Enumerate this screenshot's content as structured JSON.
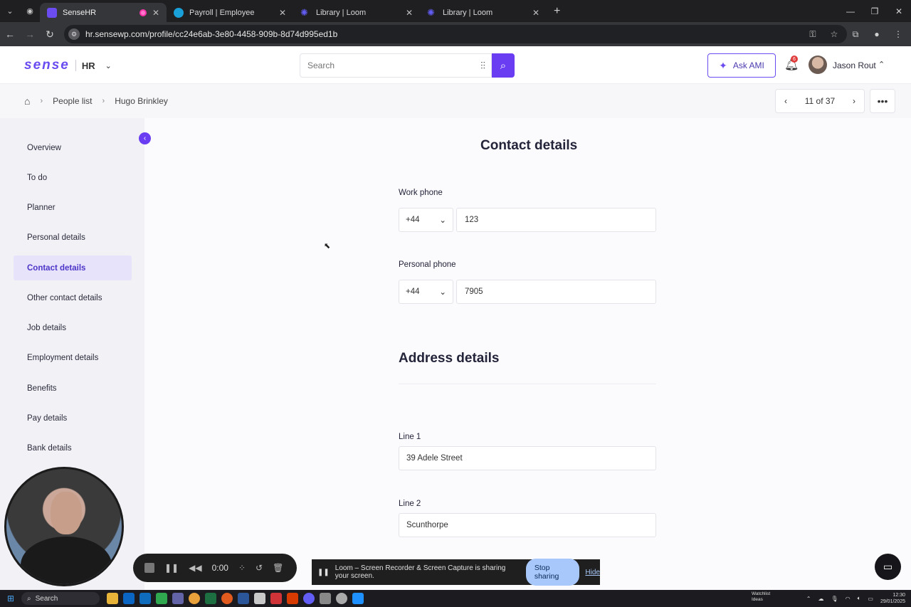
{
  "browser": {
    "tabs": [
      {
        "title": "SenseHR",
        "active": true,
        "color": "#6a4cf0"
      },
      {
        "title": "Payroll | Employee",
        "active": false,
        "color": "#1aa0d8"
      },
      {
        "title": "Library | Loom",
        "active": false,
        "color": "#625df5"
      },
      {
        "title": "Library | Loom",
        "active": false,
        "color": "#625df5"
      }
    ],
    "url": "hr.sensewp.com/profile/cc24e6ab-3e80-4458-909b-8d74d995ed1b"
  },
  "header": {
    "logo": "sense",
    "product": "HR",
    "search_placeholder": "Search",
    "ask_label": "Ask AMI",
    "notification_count": "6",
    "user_name": "Jason Rout"
  },
  "breadcrumb": {
    "items": [
      "People list",
      "Hugo Brinkley"
    ]
  },
  "pager": {
    "label": "11 of 37"
  },
  "sidebar": {
    "items": [
      {
        "label": "Overview"
      },
      {
        "label": "To do"
      },
      {
        "label": "Planner"
      },
      {
        "label": "Personal details"
      },
      {
        "label": "Contact details",
        "active": true
      },
      {
        "label": "Other contact details"
      },
      {
        "label": "Job details"
      },
      {
        "label": "Employment details"
      },
      {
        "label": "Benefits"
      },
      {
        "label": "Pay details"
      },
      {
        "label": "Bank details"
      }
    ]
  },
  "contact": {
    "title": "Contact details",
    "work_phone_label": "Work phone",
    "work_phone_code": "+44",
    "work_phone_value": "123",
    "personal_phone_label": "Personal phone",
    "personal_phone_code": "+44",
    "personal_phone_value": "7905"
  },
  "address": {
    "title": "Address details",
    "line1_label": "Line 1",
    "line1_value": "39 Adele Street",
    "line2_label": "Line 2",
    "line2_value": "Scunthorpe"
  },
  "loom": {
    "timer": "0:00",
    "share_message": "Loom – Screen Recorder & Screen Capture is sharing your screen.",
    "stop_label": "Stop sharing",
    "hide_label": "Hide"
  },
  "taskbar": {
    "search_label": "Search",
    "widget_title": "Watchlist",
    "widget_sub": "Ideas",
    "time": "12:30",
    "date": "29/01/2025"
  },
  "colors": {
    "accent": "#6a3cf2",
    "active_nav_bg": "#e6e3fb"
  }
}
